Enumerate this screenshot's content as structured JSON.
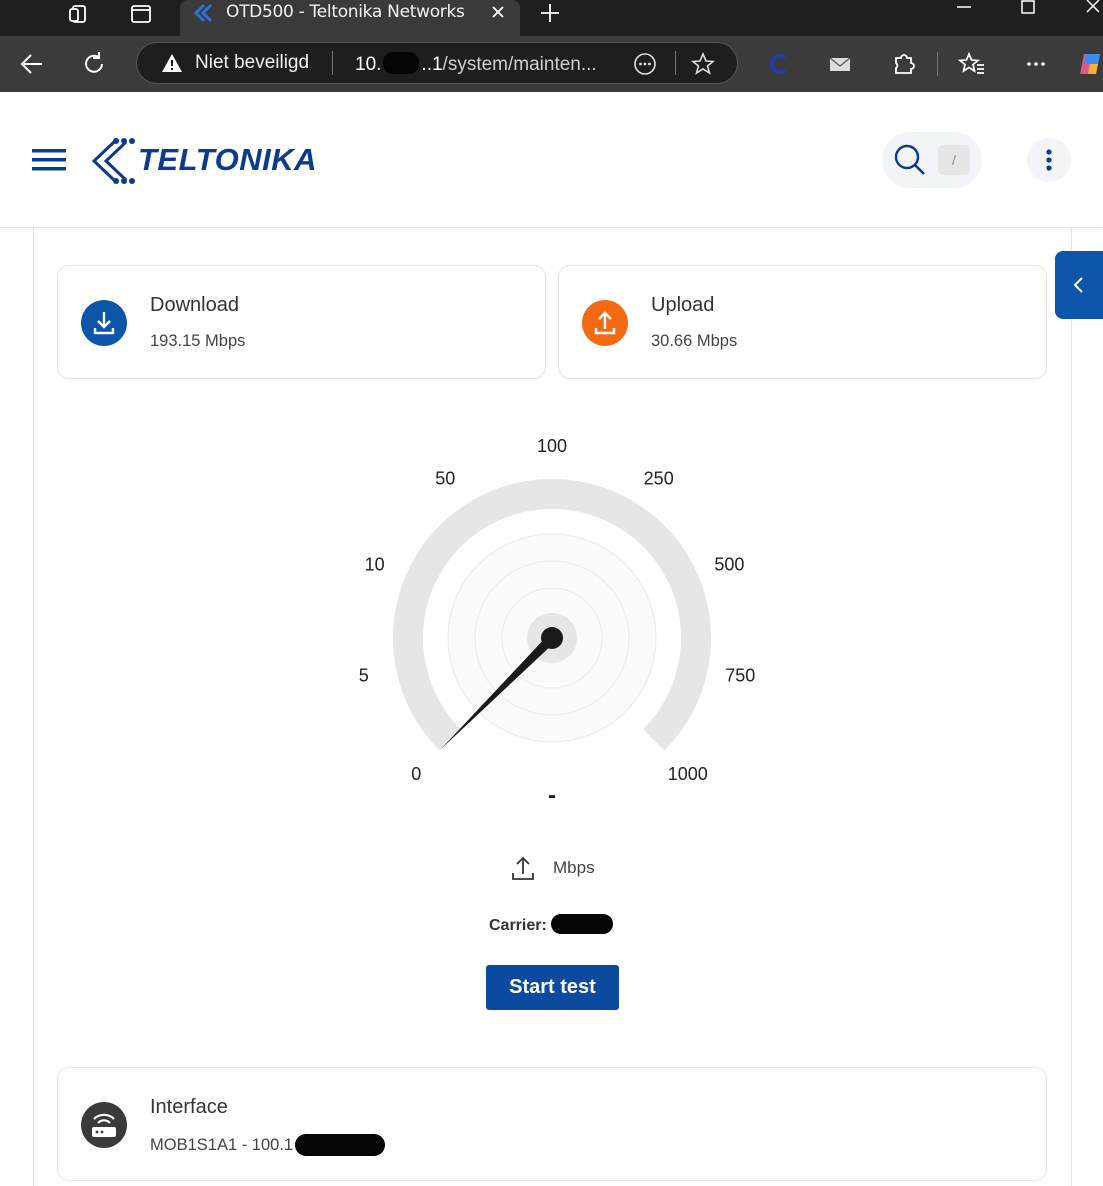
{
  "browser": {
    "tab_title": "OTD500 - Teltonika Networks",
    "security_label": "Niet beveiligd",
    "url_host_start": "10.",
    "url_host_end": "..1",
    "url_path": "/system/mainten..."
  },
  "header": {
    "logo_text": "TELTONIKA",
    "search_shortcut": "/"
  },
  "stats": {
    "download": {
      "label": "Download",
      "value": "193.15 Mbps",
      "color": "#0c55a8"
    },
    "upload": {
      "label": "Upload",
      "value": "30.66 Mbps",
      "color": "#f36a12"
    }
  },
  "gauge": {
    "ticks": [
      "0",
      "5",
      "10",
      "50",
      "100",
      "250",
      "500",
      "750",
      "1000"
    ],
    "current_value": 0,
    "readout": "-",
    "unit": "Mbps",
    "direction_icon": "upload-arrow-icon"
  },
  "carrier": {
    "label": "Carrier:"
  },
  "actions": {
    "start_label": "Start test",
    "accent": "#0c4aa0"
  },
  "interface": {
    "label": "Interface",
    "value": "MOB1S1A1 - 100.1"
  }
}
